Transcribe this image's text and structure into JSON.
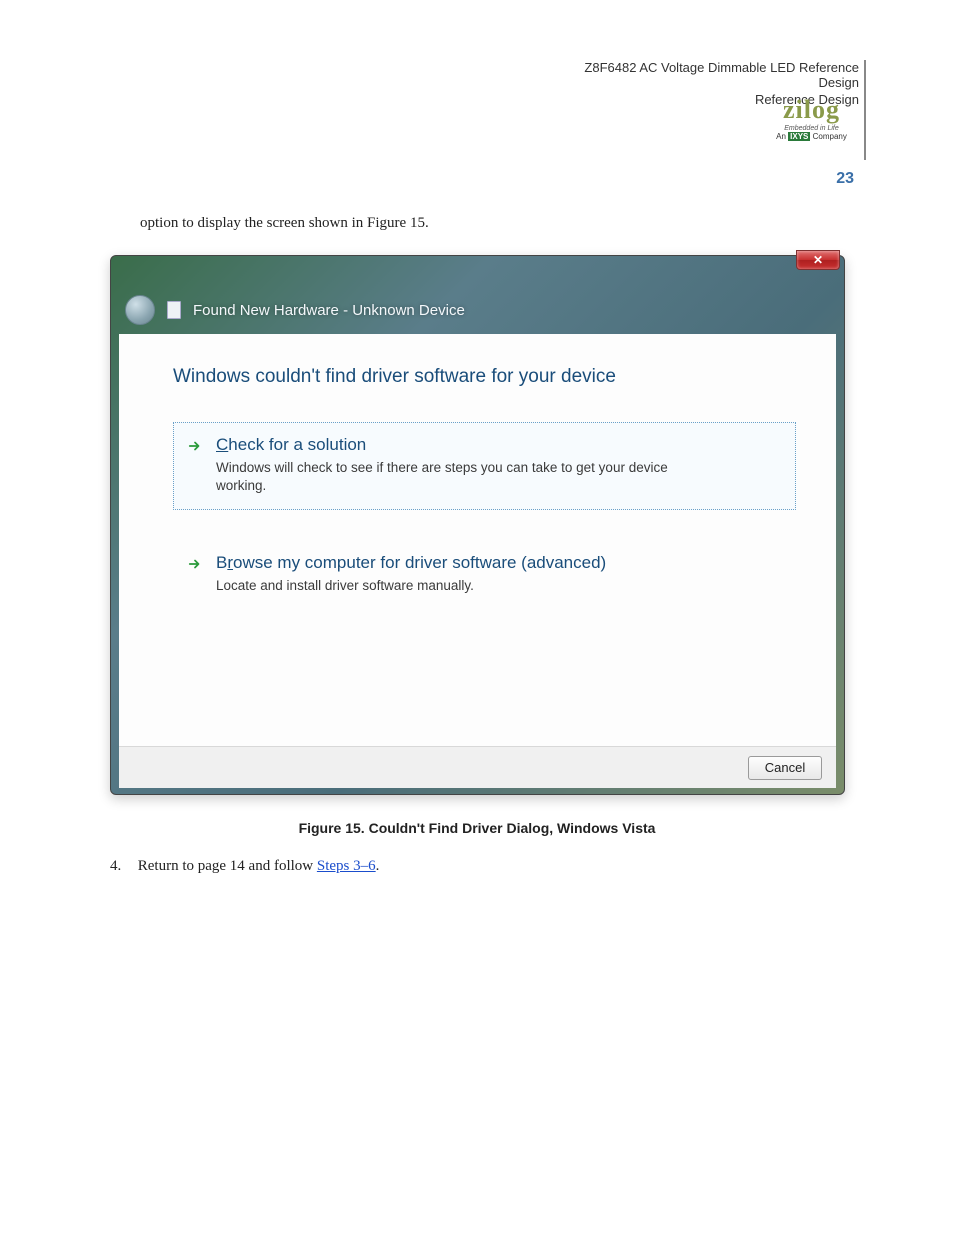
{
  "header": {
    "doc_title": "Z8F6482 AC Voltage Dimmable LED Reference Design",
    "doc_subtitle": "Reference Design",
    "page_number": "23"
  },
  "logo": {
    "brand": "zilog",
    "tag1": "Embedded in Life",
    "tag2_prefix": "An ",
    "tag2_brand": "IXYS",
    "tag2_suffix": " Company"
  },
  "pre_option_text": "option to display the screen shown in Figure 15.",
  "dialog": {
    "title": "Found New Hardware - Unknown Device",
    "heading": "Windows couldn't find driver software for your device",
    "option1_title_pre": "",
    "option1_title_u": "C",
    "option1_title_post": "heck for a solution",
    "option1_desc": "Windows will check to see if there are steps you can take to get your device working.",
    "option2_title_pre": "B",
    "option2_title_u": "r",
    "option2_title_post": "owse my computer for driver software (advanced)",
    "option2_desc": "Locate and install driver software manually.",
    "cancel": "Cancel",
    "close_icon": "✕"
  },
  "figure_caption": "Figure 15. Couldn't Find Driver Dialog, Windows Vista",
  "step4": {
    "num": "4.",
    "text_pre": "Return to page 14 and follow ",
    "link_text": "Steps 3–6",
    "text_post": "."
  }
}
